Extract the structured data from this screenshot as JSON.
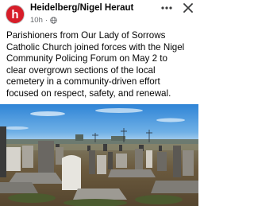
{
  "post": {
    "page_name": "Heidelberg/Nigel Heraut",
    "time": "10h",
    "separator": "·",
    "more_icon": "more-horizontal-icon",
    "close_icon": "close-icon",
    "privacy_icon": "globe-icon",
    "avatar_letter": "h",
    "avatar_color": "#d71d29",
    "text_lines": [
      "Parishioners from Our Lady of Sorrows",
      "Catholic Church joined forces with the Nigel",
      "Community Policing Forum on May 2 to",
      "clear overgrown sections of the local",
      "cemetery in a community-driven effort",
      "focused on respect, safety, and renewal."
    ],
    "photo": "cemetery-photo",
    "photo_sky_color": "#3b8fd8",
    "photo_grass_color": "#6b5a3e"
  }
}
